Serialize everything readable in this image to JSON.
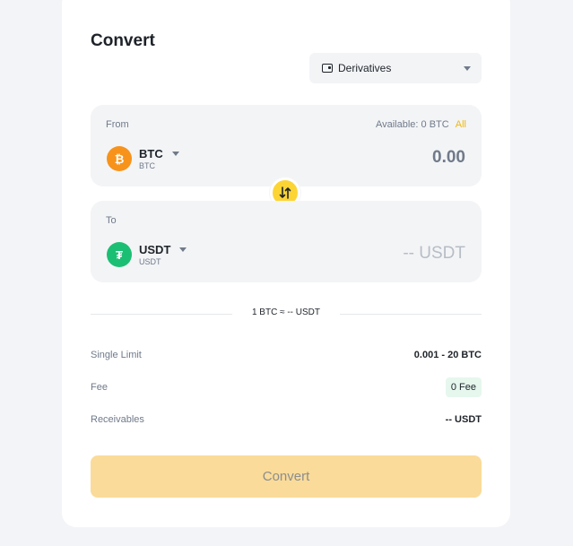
{
  "title": "Convert",
  "account": {
    "label": "Derivatives",
    "icon": "wallet-icon"
  },
  "from": {
    "label": "From",
    "available_label": "Available: 0 BTC",
    "all_label": "All",
    "coin_symbol": "BTC",
    "coin_name": "BTC",
    "coin_glyph": "₿",
    "amount": "0.00"
  },
  "to": {
    "label": "To",
    "coin_symbol": "USDT",
    "coin_name": "USDT",
    "coin_glyph": "₮",
    "amount_placeholder": "-- USDT"
  },
  "rate": "1 BTC ≈ -- USDT",
  "details": {
    "single_limit_label": "Single Limit",
    "single_limit_value": "0.001 - 20 BTC",
    "fee_label": "Fee",
    "fee_value": "0 Fee",
    "receivables_label": "Receivables",
    "receivables_value": "-- USDT"
  },
  "convert_button": "Convert",
  "colors": {
    "accent": "#f0b90b",
    "button_disabled": "#fadb99",
    "btc": "#f7931a",
    "usdt": "#1bbf73",
    "fee_green": "#03a66d"
  }
}
